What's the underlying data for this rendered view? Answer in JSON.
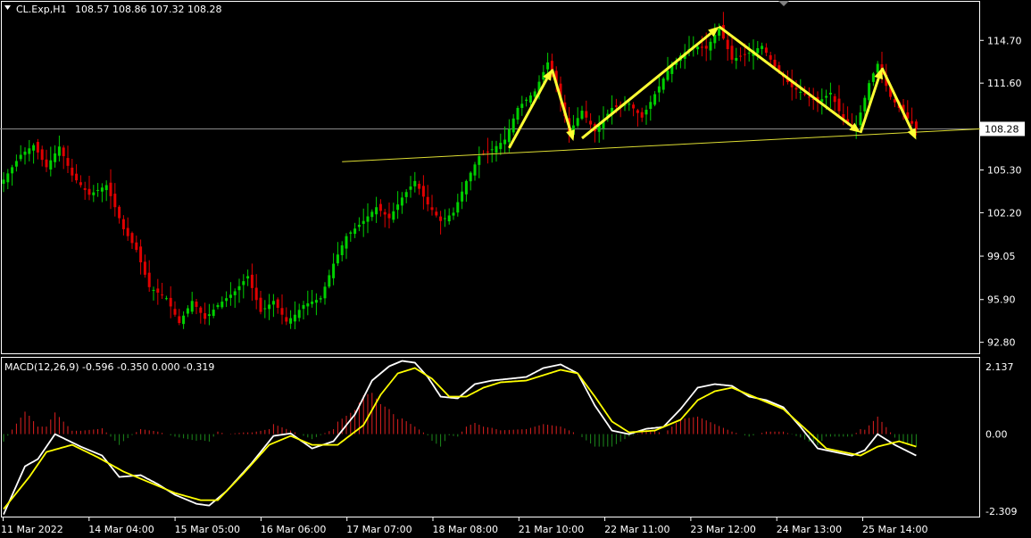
{
  "header": {
    "symbol": "CL.Exp,H1",
    "ohlc": "108.57 108.86 107.32 108.28"
  },
  "indicator": {
    "label": "MACD(12,26,9) -0.596 -0.350 0.000 -0.319"
  },
  "current_price": "108.28",
  "colors": {
    "background": "#000000",
    "bull_candle": "#00d000",
    "bear_candle": "#e00000",
    "histogram_up": "#e02020",
    "histogram_down": "#1c8a1c",
    "macd_line": "#ffffff",
    "signal_line": "#ffff00",
    "annotation": "#ffff33",
    "support_line": "#dddd33"
  },
  "chart_data": {
    "type": "candlestick",
    "price_axis_ticks": [
      "114.70",
      "111.60",
      "108.28",
      "105.30",
      "102.20",
      "99.05",
      "95.90",
      "92.80"
    ],
    "macd_axis_ticks": [
      "2.137",
      "0.00",
      "-2.309"
    ],
    "time_labels": [
      "11 Mar 2022",
      "14 Mar 04:00",
      "15 Mar 05:00",
      "16 Mar 06:00",
      "17 Mar 07:00",
      "18 Mar 08:00",
      "21 Mar 10:00",
      "22 Mar 11:00",
      "23 Mar 12:00",
      "24 Mar 13:00",
      "25 Mar 14:00"
    ],
    "price_range": [
      92.0,
      117.5
    ],
    "macd_range": [
      -2.309,
      2.137
    ],
    "price_path": [
      [
        0,
        104.6
      ],
      [
        4,
        106.4
      ],
      [
        7,
        107.1
      ],
      [
        10,
        105.5
      ],
      [
        13,
        107.0
      ],
      [
        16,
        104.9
      ],
      [
        20,
        103.5
      ],
      [
        24,
        104.2
      ],
      [
        28,
        101.0
      ],
      [
        31,
        99.5
      ],
      [
        34,
        96.8
      ],
      [
        38,
        96.0
      ],
      [
        41,
        94.2
      ],
      [
        44,
        95.8
      ],
      [
        47,
        94.5
      ],
      [
        50,
        95.5
      ],
      [
        54,
        96.5
      ],
      [
        57,
        97.6
      ],
      [
        60,
        95.0
      ],
      [
        63,
        95.8
      ],
      [
        66,
        94.3
      ],
      [
        68,
        94.8
      ],
      [
        70,
        95.5
      ],
      [
        74,
        96.0
      ],
      [
        77,
        98.5
      ],
      [
        80,
        100.5
      ],
      [
        84,
        101.6
      ],
      [
        87,
        102.6
      ],
      [
        90,
        101.8
      ],
      [
        93,
        103.3
      ],
      [
        96,
        104.5
      ],
      [
        99,
        102.8
      ],
      [
        102,
        101.6
      ],
      [
        105,
        102.2
      ],
      [
        108,
        104.5
      ],
      [
        111,
        106.3
      ],
      [
        114,
        106.8
      ],
      [
        117,
        107.5
      ],
      [
        120,
        109.8
      ],
      [
        124,
        111.0
      ],
      [
        127,
        113.1
      ],
      [
        129,
        111.6
      ],
      [
        132,
        108.0
      ],
      [
        135,
        109.6
      ],
      [
        138,
        108.1
      ],
      [
        142,
        109.8
      ],
      [
        146,
        110.1
      ],
      [
        149,
        109.1
      ],
      [
        152,
        110.8
      ],
      [
        155,
        112.5
      ],
      [
        158,
        113.6
      ],
      [
        161,
        114.3
      ],
      [
        164,
        114.1
      ],
      [
        167,
        115.6
      ],
      [
        170,
        113.3
      ],
      [
        174,
        113.8
      ],
      [
        177,
        114.3
      ],
      [
        180,
        112.8
      ],
      [
        184,
        111.3
      ],
      [
        187,
        110.8
      ],
      [
        190,
        110.2
      ],
      [
        193,
        110.9
      ],
      [
        196,
        108.9
      ],
      [
        199,
        108.4
      ],
      [
        202,
        111.6
      ],
      [
        204,
        113.0
      ],
      [
        207,
        110.6
      ],
      [
        210,
        109.4
      ],
      [
        213,
        108.28
      ]
    ],
    "macd_line_path": [
      [
        0,
        -2.25
      ],
      [
        5,
        -0.9
      ],
      [
        8,
        -0.7
      ],
      [
        12,
        0.0
      ],
      [
        18,
        -0.35
      ],
      [
        23,
        -0.6
      ],
      [
        27,
        -1.2
      ],
      [
        32,
        -1.15
      ],
      [
        36,
        -1.4
      ],
      [
        40,
        -1.7
      ],
      [
        45,
        -1.95
      ],
      [
        48,
        -2.0
      ],
      [
        52,
        -1.6
      ],
      [
        58,
        -0.8
      ],
      [
        63,
        -0.05
      ],
      [
        67,
        0.02
      ],
      [
        72,
        -0.4
      ],
      [
        77,
        -0.2
      ],
      [
        82,
        0.55
      ],
      [
        86,
        1.5
      ],
      [
        90,
        1.9
      ],
      [
        93,
        2.05
      ],
      [
        96,
        2.0
      ],
      [
        99,
        1.6
      ],
      [
        102,
        1.05
      ],
      [
        106,
        1.0
      ],
      [
        110,
        1.4
      ],
      [
        114,
        1.5
      ],
      [
        118,
        1.55
      ],
      [
        122,
        1.6
      ],
      [
        126,
        1.85
      ],
      [
        130,
        1.95
      ],
      [
        134,
        1.7
      ],
      [
        138,
        0.8
      ],
      [
        142,
        0.1
      ],
      [
        146,
        0.0
      ],
      [
        150,
        0.15
      ],
      [
        154,
        0.2
      ],
      [
        158,
        0.7
      ],
      [
        162,
        1.3
      ],
      [
        166,
        1.4
      ],
      [
        170,
        1.35
      ],
      [
        174,
        1.05
      ],
      [
        178,
        0.95
      ],
      [
        182,
        0.75
      ],
      [
        186,
        0.2
      ],
      [
        190,
        -0.4
      ],
      [
        194,
        -0.5
      ],
      [
        198,
        -0.6
      ],
      [
        201,
        -0.45
      ],
      [
        204,
        0.0
      ],
      [
        208,
        -0.3
      ],
      [
        213,
        -0.6
      ]
    ],
    "signal_line_path": [
      [
        0,
        -2.1
      ],
      [
        6,
        -1.2
      ],
      [
        10,
        -0.5
      ],
      [
        16,
        -0.3
      ],
      [
        22,
        -0.65
      ],
      [
        28,
        -1.05
      ],
      [
        34,
        -1.35
      ],
      [
        40,
        -1.65
      ],
      [
        46,
        -1.85
      ],
      [
        50,
        -1.85
      ],
      [
        56,
        -1.1
      ],
      [
        62,
        -0.3
      ],
      [
        67,
        -0.05
      ],
      [
        72,
        -0.3
      ],
      [
        78,
        -0.3
      ],
      [
        84,
        0.25
      ],
      [
        88,
        1.1
      ],
      [
        92,
        1.7
      ],
      [
        96,
        1.85
      ],
      [
        100,
        1.55
      ],
      [
        104,
        1.05
      ],
      [
        108,
        1.05
      ],
      [
        112,
        1.3
      ],
      [
        116,
        1.45
      ],
      [
        122,
        1.5
      ],
      [
        126,
        1.65
      ],
      [
        130,
        1.8
      ],
      [
        134,
        1.7
      ],
      [
        138,
        1.05
      ],
      [
        142,
        0.35
      ],
      [
        146,
        0.05
      ],
      [
        152,
        0.1
      ],
      [
        158,
        0.4
      ],
      [
        162,
        0.95
      ],
      [
        166,
        1.2
      ],
      [
        170,
        1.3
      ],
      [
        176,
        1.0
      ],
      [
        182,
        0.7
      ],
      [
        188,
        0.05
      ],
      [
        192,
        -0.4
      ],
      [
        196,
        -0.5
      ],
      [
        200,
        -0.6
      ],
      [
        204,
        -0.35
      ],
      [
        209,
        -0.2
      ],
      [
        213,
        -0.35
      ]
    ],
    "support_line": [
      [
        79,
        105.9
      ],
      [
        235,
        108.28
      ]
    ],
    "pattern_arrows": [
      [
        [
          118,
          106.9
        ],
        [
          128,
          112.6
        ]
      ],
      [
        [
          128,
          112.6
        ],
        [
          133,
          107.4
        ]
      ],
      [
        [
          135,
          107.6
        ],
        [
          167,
          115.7
        ]
      ],
      [
        [
          167,
          115.7
        ],
        [
          200,
          108.0
        ]
      ],
      [
        [
          200,
          108.0
        ],
        [
          205,
          112.7
        ]
      ],
      [
        [
          205,
          112.7
        ],
        [
          213,
          107.5
        ]
      ]
    ]
  }
}
